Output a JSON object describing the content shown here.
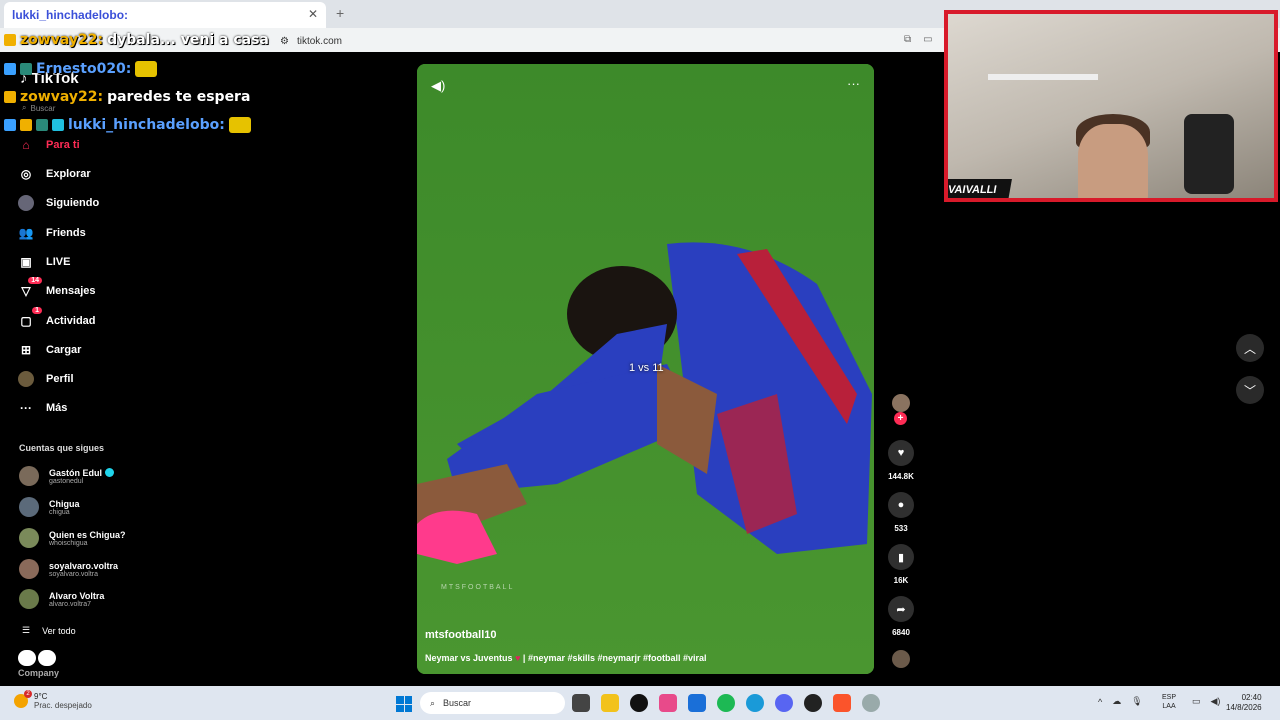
{
  "browser": {
    "tab_title": "lukki_hinchadelobo:",
    "url": "tiktok.com"
  },
  "chat": [
    {
      "user": "zowvay22:",
      "message": "dybala... veni a casa"
    },
    {
      "user": "Ernesto020:",
      "message": ""
    },
    {
      "user": "zowvay22:",
      "message": "paredes te espera"
    },
    {
      "user": "lukki_hinchadelobo:",
      "message": ""
    }
  ],
  "sidebar": {
    "logo": "TikTok",
    "search_placeholder": "Buscar",
    "items": [
      {
        "label": "Para ti",
        "icon": "home-icon",
        "badge": ""
      },
      {
        "label": "Explorar",
        "icon": "compass-icon",
        "badge": ""
      },
      {
        "label": "Siguiendo",
        "icon": "following-avatar-icon",
        "badge": ""
      },
      {
        "label": "Friends",
        "icon": "friends-icon",
        "badge": ""
      },
      {
        "label": "LIVE",
        "icon": "live-tv-icon",
        "badge": ""
      },
      {
        "label": "Mensajes",
        "icon": "send-icon",
        "badge": "14"
      },
      {
        "label": "Actividad",
        "icon": "activity-icon",
        "badge": "1"
      },
      {
        "label": "Cargar",
        "icon": "upload-plus-icon",
        "badge": ""
      },
      {
        "label": "Perfil",
        "icon": "profile-avatar-icon",
        "badge": ""
      },
      {
        "label": "Más",
        "icon": "more-dots-icon",
        "badge": ""
      }
    ],
    "following_title": "Cuentas que sigues",
    "accounts": [
      {
        "name": "Gastón Edul",
        "handle": "gastonedul",
        "verified": true
      },
      {
        "name": "Chigua",
        "handle": "chigua",
        "verified": false
      },
      {
        "name": "Quien es Chigua?",
        "handle": "whoischigua",
        "verified": false
      },
      {
        "name": "soyalvaro.voltra",
        "handle": "soyalvaro.voltra",
        "verified": false
      },
      {
        "name": "Alvaro Voltra",
        "handle": "alvaro.voltra7",
        "verified": false
      }
    ],
    "see_all": "Ver todo",
    "company": "Company"
  },
  "video": {
    "overlay_text": "1 vs 11",
    "watermark": "MTSFOOTBALL",
    "author": "mtsfootball10",
    "caption_prefix": "Neymar vs Juventus",
    "caption_suffix": "| #neymar #skills #neymarjr #football #viral"
  },
  "actions": {
    "likes": "144.8K",
    "comments": "533",
    "saves": "16K",
    "shares": "6840"
  },
  "webcam": {
    "overlay_text": "VAIVALLI"
  },
  "taskbar": {
    "temperature": "9°C",
    "weather_desc": "Prac. despejado",
    "weather_badge": "2",
    "search_label": "Buscar",
    "lang_top": "ESP",
    "lang_bottom": "LAA",
    "time": "02:40",
    "date": "14/8/2026"
  },
  "colors": {
    "accent": "#fe2c55",
    "webcam_border": "#d81a2a",
    "pitch": "#4c9a33",
    "jersey_blue": "#2a3fbf",
    "jersey_red": "#b8203a"
  }
}
